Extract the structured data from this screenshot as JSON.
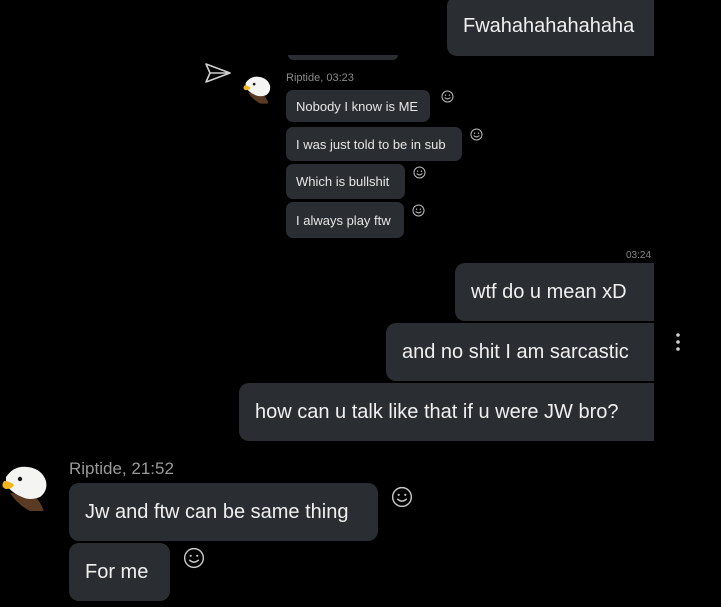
{
  "colors": {
    "background": "#000000",
    "bubble": "#2a2d31",
    "meta_text": "#9a9a9a",
    "bubble_text": "#f0f0f0"
  },
  "embedded_screenshot": {
    "sender_meta": "Riptide, 03:23",
    "messages": [
      {
        "text": "Nobody I know is ME"
      },
      {
        "text": "I was just told to be in sub"
      },
      {
        "text": "Which is bullshit"
      },
      {
        "text": "I always play ftw"
      }
    ]
  },
  "outgoing": {
    "top_message": "Fwahahahahahaha",
    "timestamp": "03:24",
    "messages": [
      {
        "text": "wtf do u mean xD"
      },
      {
        "text": "and no shit I am sarcastic"
      },
      {
        "text": "how can u talk like that if u were JW bro?"
      }
    ]
  },
  "incoming": {
    "sender_meta": "Riptide, 21:52",
    "messages": [
      {
        "text": "Jw and ftw can be same thing"
      },
      {
        "text": "For me"
      }
    ]
  },
  "icons": {
    "send": "send-icon",
    "emoji": "smiley-icon",
    "more": "more-vertical-icon",
    "avatar": "eagle-avatar"
  }
}
